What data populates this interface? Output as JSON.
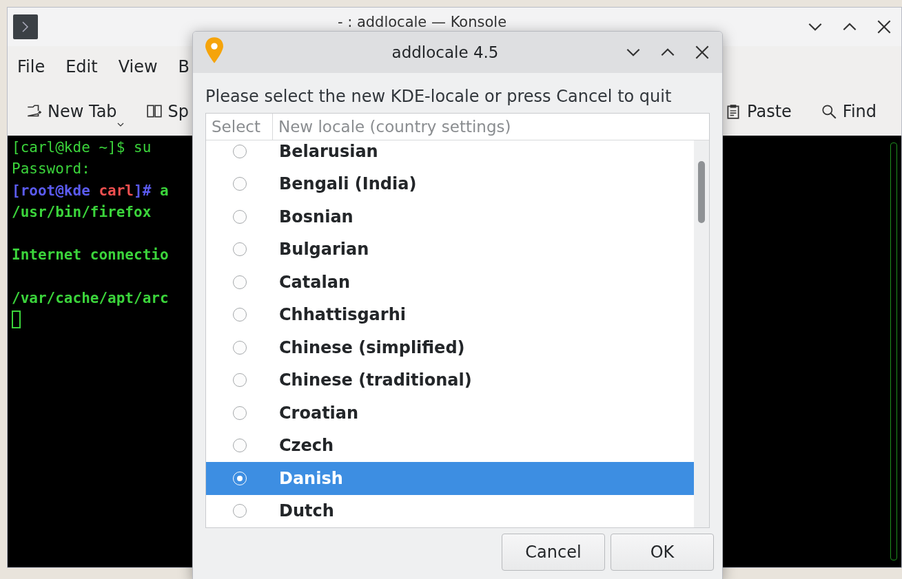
{
  "konsole": {
    "title": "- : addlocale — Konsole",
    "menu": [
      "File",
      "Edit",
      "View",
      "B"
    ],
    "toolbar": [
      {
        "label": "New Tab",
        "dropdown": true
      },
      {
        "label": "Sp",
        "dropdown": false
      },
      {
        "label": "Paste",
        "dropdown": false
      },
      {
        "label": "Find",
        "dropdown": false
      }
    ],
    "terminal": {
      "cursor": true,
      "lines": [
        {
          "gap_before": false,
          "segments": [
            {
              "text": "[carl@kde ~]$ su",
              "kind": "plain"
            }
          ]
        },
        {
          "gap_before": false,
          "segments": [
            {
              "text": "Password:",
              "kind": "plain"
            }
          ]
        },
        {
          "gap_before": false,
          "segments": [
            {
              "text": "[root@kde ",
              "kind": "prompt"
            },
            {
              "text": "carl",
              "kind": "path"
            },
            {
              "text": "]# ",
              "kind": "prompt"
            },
            {
              "text": "a",
              "kind": "output"
            }
          ]
        },
        {
          "gap_before": false,
          "segments": [
            {
              "text": "/usr/bin/firefox",
              "kind": "output"
            }
          ]
        },
        {
          "gap_before": true,
          "segments": [
            {
              "text": "Internet connectio",
              "kind": "output"
            }
          ]
        },
        {
          "gap_before": true,
          "segments": [
            {
              "text": "/var/cache/apt/arc",
              "kind": "output"
            }
          ]
        }
      ]
    }
  },
  "dialog": {
    "title": "addlocale 4.5",
    "prompt": "Please select the new KDE-locale or press Cancel to quit",
    "columns": [
      "Select",
      "New locale (country settings)"
    ],
    "rows": [
      {
        "name": "Belarusian",
        "selected": false
      },
      {
        "name": "Bengali (India)",
        "selected": false
      },
      {
        "name": "Bosnian",
        "selected": false
      },
      {
        "name": "Bulgarian",
        "selected": false
      },
      {
        "name": "Catalan",
        "selected": false
      },
      {
        "name": "Chhattisgarhi",
        "selected": false
      },
      {
        "name": "Chinese (simplified)",
        "selected": false
      },
      {
        "name": "Chinese (traditional)",
        "selected": false
      },
      {
        "name": "Croatian",
        "selected": false
      },
      {
        "name": "Czech",
        "selected": false
      },
      {
        "name": "Danish",
        "selected": true
      },
      {
        "name": "Dutch",
        "selected": false
      }
    ],
    "buttons": [
      "Cancel",
      "OK"
    ]
  }
}
